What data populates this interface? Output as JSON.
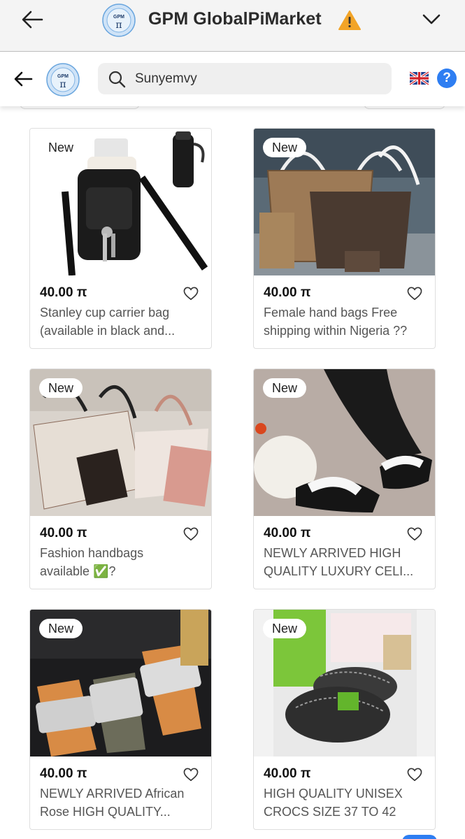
{
  "appbar": {
    "title": "GPM GlobalPiMarket"
  },
  "search": {
    "value": "Sunyemvy"
  },
  "brand": {
    "accent": "#2e7ef2",
    "logo_text": "GPM"
  },
  "products": [
    {
      "badge": "New",
      "price": "40.00 π",
      "name_line1": "Stanley cup carrier bag",
      "name_line2": "(available in black and..."
    },
    {
      "badge": "New",
      "price": "40.00 π",
      "name_line1": "Female hand bags Free",
      "name_line2": "shipping within Nigeria ??"
    },
    {
      "badge": "New",
      "price": "40.00 π",
      "name_line1": "Fashion handbags",
      "name_line2": "available ✅?"
    },
    {
      "badge": "New",
      "price": "40.00 π",
      "name_line1": "NEWLY ARRIVED HIGH",
      "name_line2": "QUALITY LUXURY CELI..."
    },
    {
      "badge": "New",
      "price": "40.00 π",
      "name_line1": "NEWLY ARRIVED African",
      "name_line2": "Rose HIGH QUALITY..."
    },
    {
      "badge": "New",
      "price": "40.00 π",
      "name_line1": "HIGH QUALITY UNISEX",
      "name_line2": "CROCS SIZE 37 TO 42"
    }
  ],
  "icons": [
    "back-arrow-icon",
    "gpm-logo-icon",
    "warning-icon",
    "chevron-down-icon",
    "search-icon",
    "uk-flag-icon",
    "help-icon",
    "heart-icon"
  ]
}
